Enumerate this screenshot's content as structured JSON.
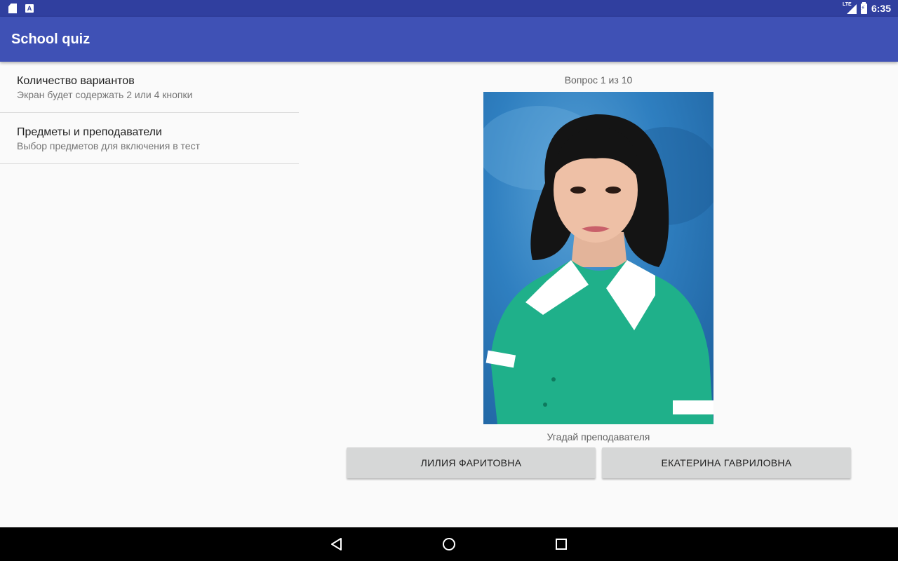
{
  "status_bar": {
    "time": "6:35",
    "network_label": "LTE",
    "icons": [
      "sd-card-icon",
      "keyboard-a-icon",
      "lte-signal-icon",
      "battery-charging-icon"
    ]
  },
  "app_bar": {
    "title": "School quiz",
    "color": "#3f51b5",
    "status_color": "#303f9f"
  },
  "settings": {
    "items": [
      {
        "title": "Количество вариантов",
        "summary": "Экран будет содержать 2 или 4 кнопки"
      },
      {
        "title": "Предметы и преподаватели",
        "summary": "Выбор предметов для включения в тест"
      }
    ]
  },
  "quiz": {
    "question_label": "Вопрос 1 из 10",
    "hint": "Угадай преподавателя",
    "answers": [
      "ЛИЛИЯ ФАРИТОВНА",
      "ЕКАТЕРИНА ГАВРИЛОВНА"
    ]
  },
  "nav_bar": {
    "icons": [
      "back-icon",
      "home-icon",
      "recents-icon"
    ]
  }
}
